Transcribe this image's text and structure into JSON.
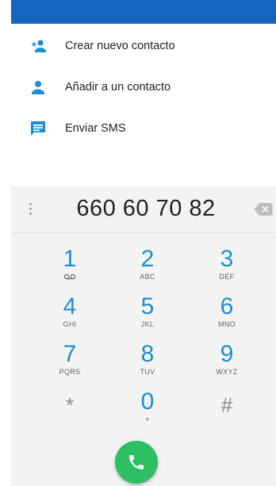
{
  "menu": {
    "items": [
      {
        "label": "Crear nuevo contacto",
        "icon": "person-add-icon"
      },
      {
        "label": "Añadir a un contacto",
        "icon": "person-icon"
      },
      {
        "label": "Enviar SMS",
        "icon": "message-icon"
      }
    ]
  },
  "dialer": {
    "number": "660 60 70 82",
    "keys": [
      {
        "digit": "1",
        "letters": "",
        "icon": "voicemail-icon"
      },
      {
        "digit": "2",
        "letters": "ABC"
      },
      {
        "digit": "3",
        "letters": "DEF"
      },
      {
        "digit": "4",
        "letters": "GHI"
      },
      {
        "digit": "5",
        "letters": "JKL"
      },
      {
        "digit": "6",
        "letters": "MNO"
      },
      {
        "digit": "7",
        "letters": "PQRS"
      },
      {
        "digit": "8",
        "letters": "TUV"
      },
      {
        "digit": "9",
        "letters": "WXYZ"
      },
      {
        "digit": "*",
        "letters": ""
      },
      {
        "digit": "0",
        "letters": "+"
      },
      {
        "digit": "#",
        "letters": ""
      }
    ]
  },
  "colors": {
    "topbar": "#1565c0",
    "accent": "#1a8fd4",
    "call": "#2fbf63"
  }
}
